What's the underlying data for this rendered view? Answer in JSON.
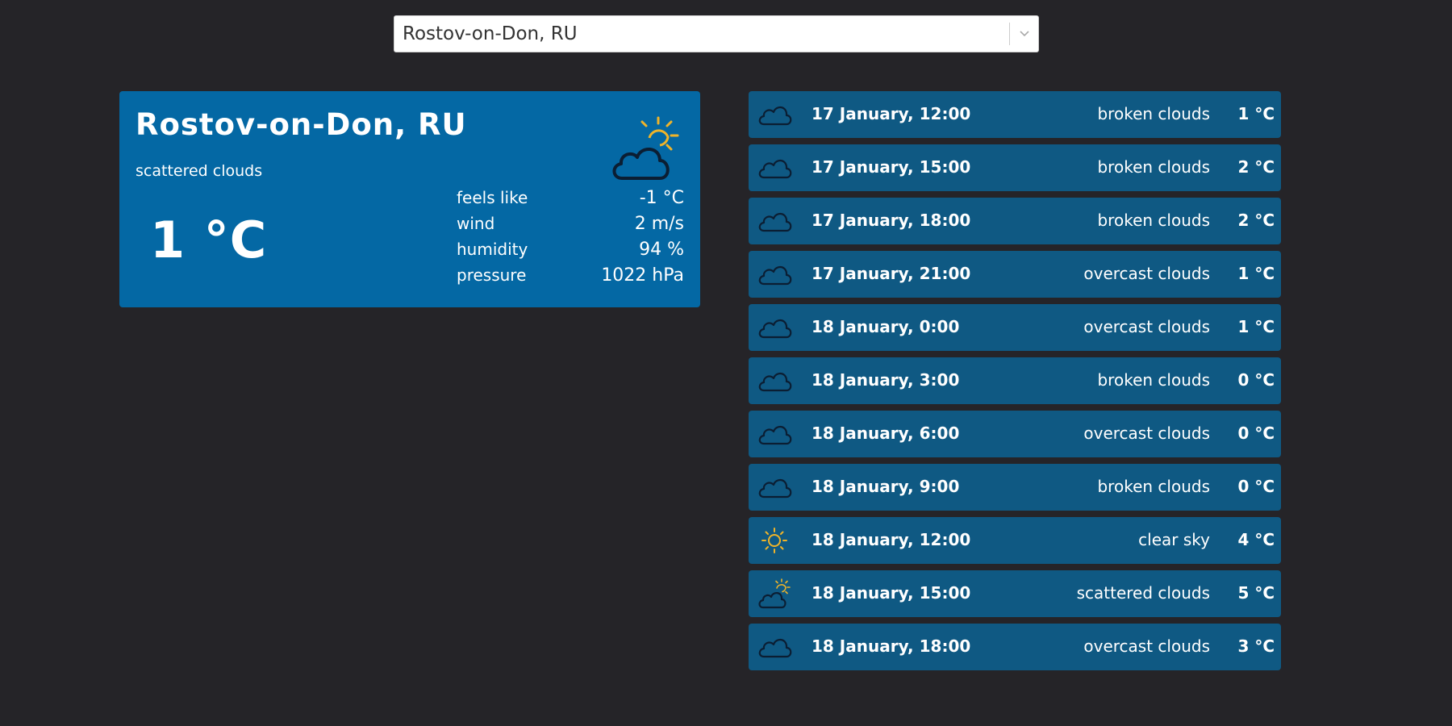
{
  "search": {
    "value": "Rostov-on-Don, RU"
  },
  "current": {
    "city": "Rostov-on-Don, RU",
    "description": "scattered clouds",
    "temperature": "1 °C",
    "icon": "partly-cloudy-icon",
    "details": [
      {
        "label": "feels like",
        "value": "-1 °C"
      },
      {
        "label": "wind",
        "value": "2 m/s"
      },
      {
        "label": "humidity",
        "value": "94 %"
      },
      {
        "label": "pressure",
        "value": "1022 hPa"
      }
    ]
  },
  "forecast": [
    {
      "time": "17 January, 12:00",
      "description": "broken clouds",
      "temp": "1 °C",
      "icon": "cloud-icon"
    },
    {
      "time": "17 January, 15:00",
      "description": "broken clouds",
      "temp": "2 °C",
      "icon": "cloud-icon"
    },
    {
      "time": "17 January, 18:00",
      "description": "broken clouds",
      "temp": "2 °C",
      "icon": "cloud-icon"
    },
    {
      "time": "17 January, 21:00",
      "description": "overcast clouds",
      "temp": "1 °C",
      "icon": "cloud-icon"
    },
    {
      "time": "18 January, 0:00",
      "description": "overcast clouds",
      "temp": "1 °C",
      "icon": "cloud-icon"
    },
    {
      "time": "18 January, 3:00",
      "description": "broken clouds",
      "temp": "0 °C",
      "icon": "cloud-icon"
    },
    {
      "time": "18 January, 6:00",
      "description": "overcast clouds",
      "temp": "0 °C",
      "icon": "cloud-icon"
    },
    {
      "time": "18 January, 9:00",
      "description": "broken clouds",
      "temp": "0 °C",
      "icon": "cloud-icon"
    },
    {
      "time": "18 January, 12:00",
      "description": "clear sky",
      "temp": "4 °C",
      "icon": "sun-icon"
    },
    {
      "time": "18 January, 15:00",
      "description": "scattered clouds",
      "temp": "5 °C",
      "icon": "partly-cloudy-icon"
    },
    {
      "time": "18 January, 18:00",
      "description": "overcast clouds",
      "temp": "3 °C",
      "icon": "cloud-icon"
    }
  ],
  "colors": {
    "background": "#252428",
    "card": "#0468a4",
    "forecast_row": "#0f5983",
    "sun": "#f0b429",
    "cloud_outline": "#0b1e33"
  }
}
